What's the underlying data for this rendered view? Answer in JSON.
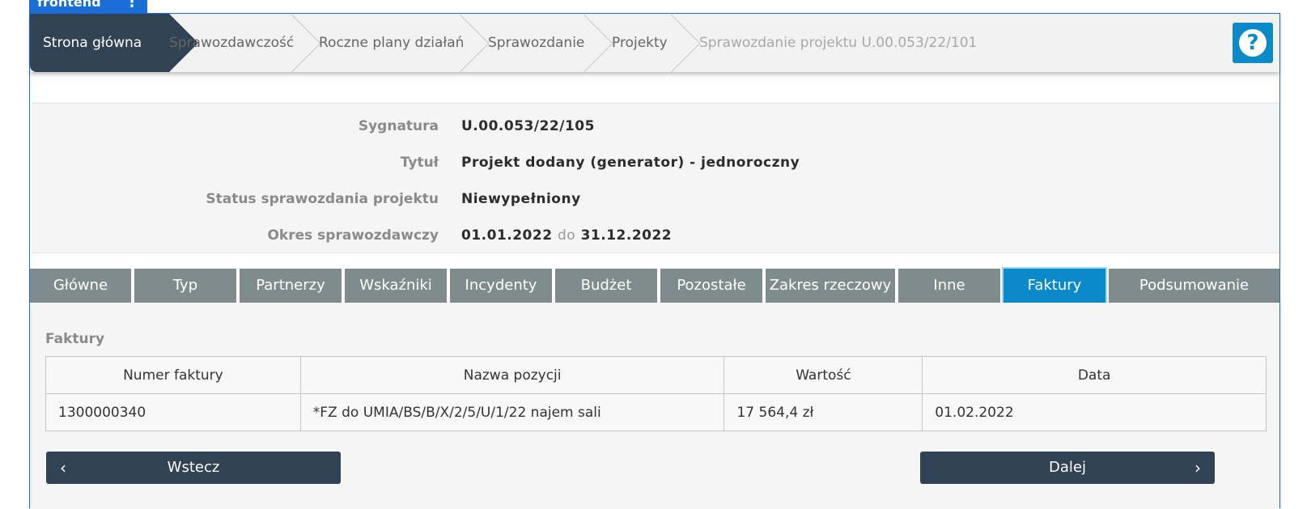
{
  "env": {
    "label": "frontend",
    "menu_icon": "kebab-icon"
  },
  "breadcrumb": {
    "home": "Strona główna",
    "items": [
      "Sprawozdawczość",
      "Roczne plany działań",
      "Sprawozdanie",
      "Projekty"
    ],
    "current": "Sprawozdanie projektu U.00.053/22/101"
  },
  "help": {
    "icon": "help-icon",
    "glyph": "?"
  },
  "info": {
    "signature_label": "Sygnatura",
    "signature_value": "U.00.053/22/105",
    "title_label": "Tytuł",
    "title_value": "Projekt dodany (generator) - jednoroczny",
    "status_label": "Status sprawozdania projektu",
    "status_value": "Niewypełniony",
    "period_label": "Okres sprawozdawczy",
    "period_from": "01.01.2022",
    "period_sep": "do",
    "period_to": "31.12.2022"
  },
  "tabs": [
    "Główne",
    "Typ",
    "Partnerzy",
    "Wskaźniki",
    "Incydenty",
    "Budżet",
    "Pozostałe",
    "Zakres rzeczowy",
    "Inne",
    "Faktury",
    "Podsumowanie"
  ],
  "active_tab": "Faktury",
  "invoices": {
    "title": "Faktury",
    "columns": [
      "Numer faktury",
      "Nazwa pozycji",
      "Wartość",
      "Data"
    ],
    "rows": [
      [
        "1300000340",
        "*FZ do UMIA/BS/B/X/2/5/U/1/22 najem sali",
        "17 564,4 zł",
        "01.02.2022"
      ]
    ]
  },
  "nav": {
    "back_label": "Wstecz",
    "next_label": "Dalej",
    "prev_glyph": "‹",
    "next_glyph": "›"
  },
  "colors": {
    "primary": "#304254",
    "accent": "#0b8ac9",
    "tab_bg": "#7f8c8d",
    "env_badge": "#1a6fd6"
  }
}
